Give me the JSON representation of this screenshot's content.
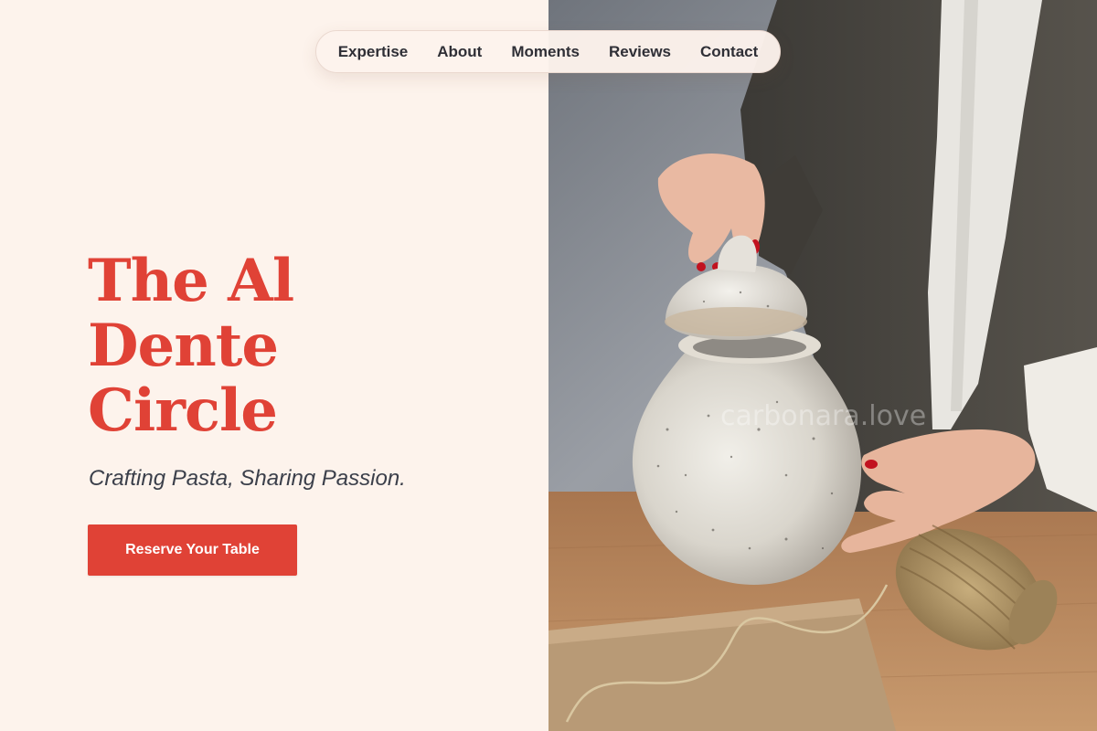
{
  "nav": {
    "items": [
      {
        "label": "Expertise"
      },
      {
        "label": "About"
      },
      {
        "label": "Moments"
      },
      {
        "label": "Reviews"
      },
      {
        "label": "Contact"
      }
    ]
  },
  "hero": {
    "title_lines": [
      "The Al",
      "Dente",
      "Circle"
    ],
    "subtitle": "Crafting Pasta, Sharing Passion.",
    "cta_label": "Reserve Your Table"
  },
  "photo": {
    "watermark": "carbonara.love"
  },
  "colors": {
    "background": "#fdf3ec",
    "accent": "#e04236",
    "nav_text": "#2f2f36",
    "subtitle_text": "#3b3f4a"
  }
}
